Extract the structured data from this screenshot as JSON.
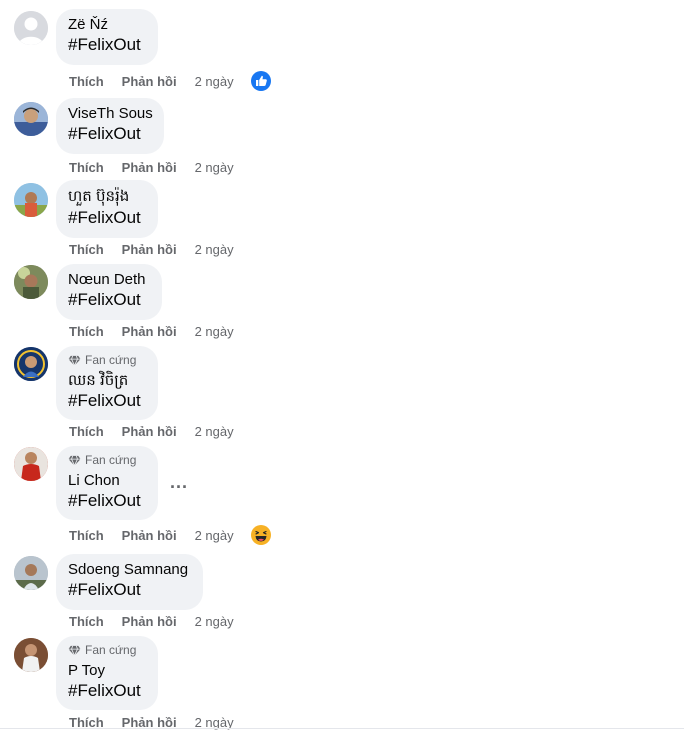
{
  "actions": {
    "like": "Thích",
    "reply": "Phản hồi"
  },
  "comments": [
    {
      "author": "Zë Ňź",
      "text": "#FelixOut",
      "time": "2 ngày",
      "badge": "",
      "reaction": "like",
      "avatar_color": "#d8dadf"
    },
    {
      "author": "ViseTh Sous",
      "text": "#FelixOut",
      "time": "2 ngày",
      "badge": "",
      "reaction": "",
      "avatar_color": "#6c86b8"
    },
    {
      "author": "ហួត ប៊ុនរ៉ុង",
      "text": "#FelixOut",
      "time": "2 ngày",
      "badge": "",
      "reaction": "",
      "avatar_color": "#8fb7d6"
    },
    {
      "author": "Nœun Deth",
      "text": "#FelixOut",
      "time": "2 ngày",
      "badge": "",
      "reaction": "",
      "avatar_color": "#6b7a55"
    },
    {
      "author": "ឈន វិចិត្រ",
      "text": "#FelixOut",
      "time": "2 ngày",
      "badge": "Fan cứng",
      "reaction": "",
      "avatar_color": "#1b3f7a"
    },
    {
      "author": "Li Chon",
      "text": "#FelixOut",
      "time": "2 ngày",
      "badge": "Fan cứng",
      "reaction": "haha",
      "avatar_color": "#c23a2a"
    },
    {
      "author": "Sdoeng Samnang",
      "text": "#FelixOut",
      "time": "2 ngày",
      "badge": "",
      "reaction": "",
      "avatar_color": "#9aa6b2"
    },
    {
      "author": "P Toy",
      "text": "#FelixOut",
      "time": "2 ngày",
      "badge": "Fan cứng",
      "reaction": "",
      "avatar_color": "#8a5a3c"
    }
  ],
  "more_options": "..."
}
